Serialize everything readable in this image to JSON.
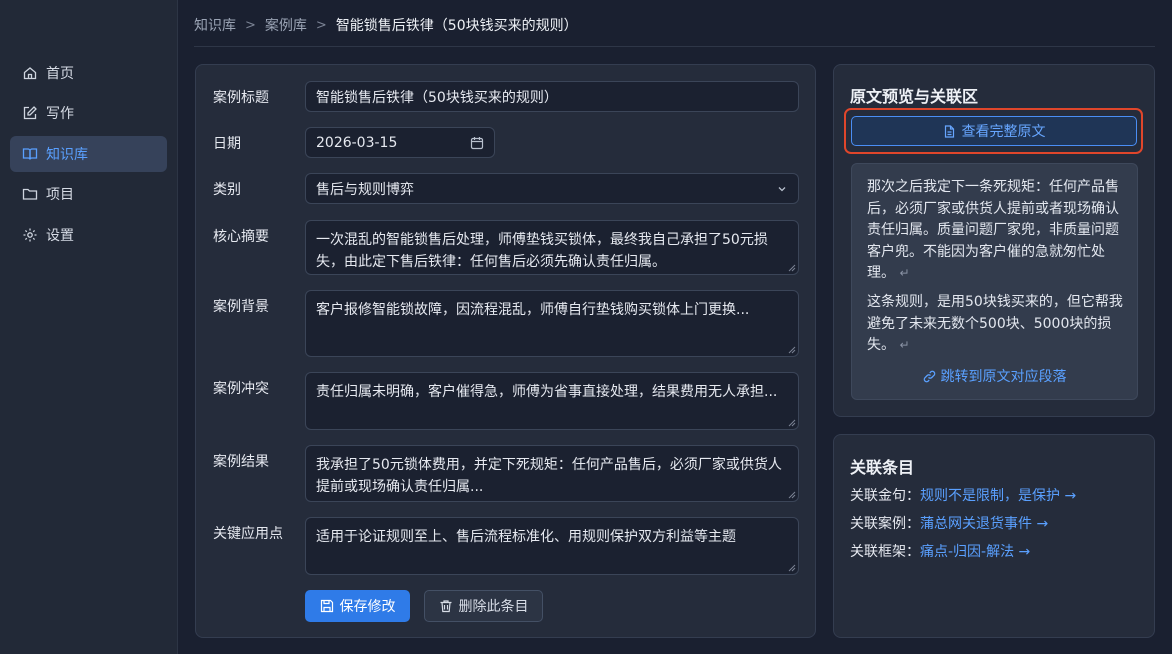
{
  "sidebar": {
    "items": [
      {
        "label": "首页",
        "icon": "home-icon"
      },
      {
        "label": "写作",
        "icon": "edit-icon"
      },
      {
        "label": "知识库",
        "icon": "book-icon",
        "active": true
      },
      {
        "label": "项目",
        "icon": "folder-icon"
      },
      {
        "label": "设置",
        "icon": "gear-icon"
      }
    ]
  },
  "breadcrumb": {
    "items": [
      "知识库",
      "案例库",
      "智能锁售后铁律（50块钱买来的规则）"
    ],
    "separator": ">"
  },
  "form": {
    "title_label": "案例标题",
    "title_value": "智能锁售后铁律（50块钱买来的规则）",
    "date_label": "日期",
    "date_value": "2026-03-15",
    "category_label": "类别",
    "category_value": "售后与规则博弈",
    "summary_label": "核心摘要",
    "summary_value": "一次混乱的智能锁售后处理，师傅垫钱买锁体，最终我自己承担了50元损失，由此定下售后铁律：任何售后必须先确认责任归属。",
    "background_label": "案例背景",
    "background_value": "客户报修智能锁故障，因流程混乱，师傅自行垫钱购买锁体上门更换...",
    "conflict_label": "案例冲突",
    "conflict_value": "责任归属未明确，客户催得急，师傅为省事直接处理，结果费用无人承担...",
    "result_label": "案例结果",
    "result_value": "我承担了50元锁体费用，并定下死规矩：任何产品售后，必须厂家或供货人提前或现场确认责任归属...",
    "keypoints_label": "关键应用点",
    "keypoints_value": "适用于论证规则至上、售后流程标准化、用规则保护双方利益等主题",
    "save_label": "保存修改",
    "delete_label": "删除此条目"
  },
  "preview": {
    "title": "原文预览与关联区",
    "view_button": "查看完整原文",
    "paragraph1": "那次之后我定下一条死规矩：任何产品售后，必须厂家或供货人提前或者现场确认责任归属。质量问题厂家兜，非质量问题客户兜。不能因为客户催的急就匆忙处理。",
    "paragraph2": "这条规则，是用50块钱买来的，但它帮我避免了未来无数个500块、5000块的损失。",
    "return_mark": "↵",
    "jump_link": "跳转到原文对应段落"
  },
  "related": {
    "title": "关联条目",
    "items": [
      {
        "label": "关联金句：",
        "link": "规则不是限制，是保护 →"
      },
      {
        "label": "关联案例：",
        "link": "蒲总网关退货事件 →"
      },
      {
        "label": "关联框架：",
        "link": "痛点-归因-解法 →"
      }
    ]
  },
  "colors": {
    "accent": "#2f7be8",
    "link": "#5aa0ff",
    "highlight": "#e0462b"
  }
}
